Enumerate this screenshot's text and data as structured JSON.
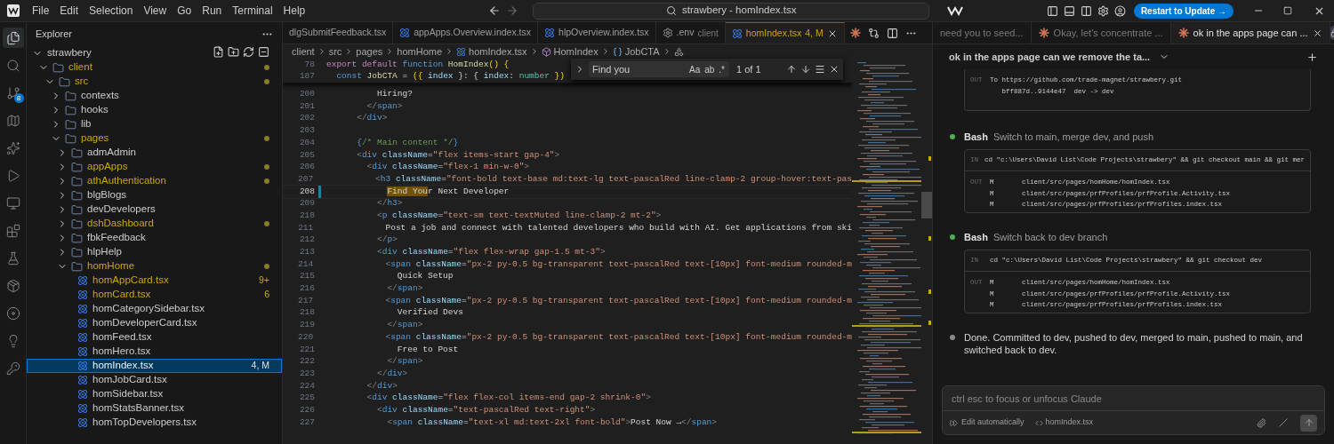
{
  "title_bar": {
    "menus": [
      "File",
      "Edit",
      "Selection",
      "View",
      "Go",
      "Run",
      "Terminal",
      "Help"
    ],
    "search": "strawbery - homIndex.tsx",
    "update_button": "Restart to Update →"
  },
  "activity_bar": [
    {
      "selected": true
    },
    {
      "selected": false
    },
    {
      "selected": false,
      "badge": "8"
    },
    {
      "selected": false
    },
    {
      "selected": false
    },
    {
      "selected": false
    },
    {
      "selected": false
    },
    {
      "selected": false
    },
    {
      "selected": false
    },
    {
      "selected": false
    },
    {
      "selected": false
    },
    {
      "selected": false
    },
    {
      "selected": false
    }
  ],
  "explorer": {
    "title": "Explorer",
    "tree": [
      {
        "kind": "folder",
        "name": "strawbery",
        "expanded": true,
        "modified": false,
        "children": [
          {
            "kind": "folder",
            "name": "client",
            "expanded": true,
            "modified": true,
            "children": [
              {
                "kind": "folder",
                "name": "src",
                "expanded": true,
                "modified": true,
                "children": [
                  {
                    "kind": "folder",
                    "name": "contexts",
                    "expanded": false,
                    "modified": false
                  },
                  {
                    "kind": "folder",
                    "name": "hooks",
                    "expanded": false,
                    "modified": false
                  },
                  {
                    "kind": "folder",
                    "name": "lib",
                    "expanded": false,
                    "modified": false
                  },
                  {
                    "kind": "folder",
                    "name": "pages",
                    "expanded": true,
                    "modified": true,
                    "children": [
                      {
                        "kind": "folder",
                        "name": "admAdmin",
                        "expanded": false,
                        "modified": false
                      },
                      {
                        "kind": "folder",
                        "name": "appApps",
                        "expanded": false,
                        "modified": true
                      },
                      {
                        "kind": "folder",
                        "name": "athAuthentication",
                        "expanded": false,
                        "modified": true
                      },
                      {
                        "kind": "folder",
                        "name": "blgBlogs",
                        "expanded": false,
                        "modified": false
                      },
                      {
                        "kind": "folder",
                        "name": "devDevelopers",
                        "expanded": false,
                        "modified": false
                      },
                      {
                        "kind": "folder",
                        "name": "dshDashboard",
                        "expanded": false,
                        "modified": true
                      },
                      {
                        "kind": "folder",
                        "name": "fbkFeedback",
                        "expanded": false,
                        "modified": false
                      },
                      {
                        "kind": "folder",
                        "name": "hlpHelp",
                        "expanded": false,
                        "modified": false
                      },
                      {
                        "kind": "folder",
                        "name": "homHome",
                        "expanded": true,
                        "modified": true,
                        "children": [
                          {
                            "kind": "file",
                            "name": "homAppCard.tsx",
                            "modified": true,
                            "badge": "9+",
                            "selected": false
                          },
                          {
                            "kind": "file",
                            "name": "homCard.tsx",
                            "modified": true,
                            "badge": "6",
                            "selected": false
                          },
                          {
                            "kind": "file",
                            "name": "homCategorySidebar.tsx",
                            "modified": false,
                            "selected": false
                          },
                          {
                            "kind": "file",
                            "name": "homDeveloperCard.tsx",
                            "modified": false,
                            "selected": false
                          },
                          {
                            "kind": "file",
                            "name": "homFeed.tsx",
                            "modified": false,
                            "selected": false
                          },
                          {
                            "kind": "file",
                            "name": "homHero.tsx",
                            "modified": false,
                            "selected": false
                          },
                          {
                            "kind": "file",
                            "name": "homIndex.tsx",
                            "modified": true,
                            "badge": "4, M",
                            "selected": true
                          },
                          {
                            "kind": "file",
                            "name": "homJobCard.tsx",
                            "modified": false,
                            "selected": false
                          },
                          {
                            "kind": "file",
                            "name": "homSidebar.tsx",
                            "modified": false,
                            "selected": false
                          },
                          {
                            "kind": "file",
                            "name": "homStatsBanner.tsx",
                            "modified": false,
                            "selected": false
                          },
                          {
                            "kind": "file",
                            "name": "homTopDevelopers.tsx",
                            "modified": false,
                            "selected": false
                          }
                        ]
                      }
                    ]
                  }
                ]
              }
            ]
          }
        ]
      }
    ]
  },
  "editor": {
    "tabs": [
      {
        "kind": "plain",
        "label": "dlgSubmitFeedback.tsx",
        "selected": false
      },
      {
        "kind": "react",
        "label": "appApps.Overview.index.tsx",
        "selected": false
      },
      {
        "kind": "react",
        "label": "hlpOverview.index.tsx",
        "selected": false
      },
      {
        "kind": "env",
        "label": ".env",
        "description": "client",
        "selected": false
      },
      {
        "kind": "react",
        "label": "homIndex.tsx",
        "decoration": "4, M",
        "selected": true
      }
    ],
    "breadcrumbs": [
      {
        "kind": "folder",
        "label": "client"
      },
      {
        "kind": "folder",
        "label": "src"
      },
      {
        "kind": "folder",
        "label": "pages"
      },
      {
        "kind": "folder",
        "label": "homHome"
      },
      {
        "kind": "react",
        "label": "homIndex.tsx"
      },
      {
        "kind": "component",
        "label": "HomIndex"
      },
      {
        "kind": "variable",
        "label": "JobCTA"
      }
    ],
    "find": {
      "value": "Find you",
      "toggles": [
        "Aa",
        "ab",
        ".*"
      ],
      "count": "1 of 1"
    },
    "sticky_lines": [
      {
        "num": "78",
        "current": false,
        "tokens": [
          {
            "t": "export default ",
            "kind": "keyword"
          },
          {
            "t": "function ",
            "kind": "storage"
          },
          {
            "t": "HomIndex",
            "kind": "function"
          },
          {
            "t": "() {",
            "kind": "bracket"
          }
        ]
      },
      {
        "num": "187",
        "current": false,
        "tokens": [
          {
            "t": "  const ",
            "kind": "storage"
          },
          {
            "t": "JobCTA",
            "kind": "function"
          },
          {
            "t": " = ",
            "kind": "punctuation"
          },
          {
            "t": "({ ",
            "kind": "bracket"
          },
          {
            "t": "index",
            "kind": "variable"
          },
          {
            "t": " }: { ",
            "kind": "punctuation"
          },
          {
            "t": "index",
            "kind": "variable"
          },
          {
            "t": ": ",
            "kind": "punctuation"
          },
          {
            "t": "number",
            "kind": "type"
          },
          {
            "t": " })",
            "kind": "bracket"
          }
        ]
      }
    ],
    "lines": [
      {
        "num": "200",
        "current": false,
        "tokens": [
          {
            "t": "          Hiring?",
            "kind": "text"
          }
        ]
      },
      {
        "num": "201",
        "current": false,
        "tokens": [
          {
            "t": "        </",
            "kind": "angle"
          },
          {
            "t": "span",
            "kind": "tag"
          },
          {
            "t": ">",
            "kind": "angle"
          }
        ]
      },
      {
        "num": "202",
        "current": false,
        "tokens": [
          {
            "t": "      </",
            "kind": "angle"
          },
          {
            "t": "div",
            "kind": "tag"
          },
          {
            "t": ">",
            "kind": "angle"
          }
        ]
      },
      {
        "num": "203",
        "current": false
      },
      {
        "num": "204",
        "current": false,
        "tokens": [
          {
            "t": "      {",
            "kind": "tag"
          },
          {
            "t": "/* Main content */",
            "kind": "comment"
          },
          {
            "t": "}",
            "kind": "tag"
          }
        ]
      },
      {
        "num": "205",
        "current": false,
        "tokens": [
          {
            "t": "      <",
            "kind": "angle"
          },
          {
            "t": "div",
            "kind": "tag"
          },
          {
            "t": " className",
            "kind": "attribute"
          },
          {
            "t": "=",
            "kind": "punctuation"
          },
          {
            "t": "\"flex items-start gap-4\"",
            "kind": "string"
          },
          {
            "t": ">",
            "kind": "angle"
          }
        ]
      },
      {
        "num": "206",
        "current": false,
        "tokens": [
          {
            "t": "        <",
            "kind": "angle"
          },
          {
            "t": "div",
            "kind": "tag"
          },
          {
            "t": " className",
            "kind": "attribute"
          },
          {
            "t": "=",
            "kind": "punctuation"
          },
          {
            "t": "\"flex-1 min-w-0\"",
            "kind": "string"
          },
          {
            "t": ">",
            "kind": "angle"
          }
        ]
      },
      {
        "num": "207",
        "current": false,
        "tokens": [
          {
            "t": "          <",
            "kind": "angle"
          },
          {
            "t": "h3",
            "kind": "tag"
          },
          {
            "t": " className",
            "kind": "attribute"
          },
          {
            "t": "=",
            "kind": "punctuation"
          },
          {
            "t": "\"font-bold text-base md:text-lg text-pascalRed line-clamp-2 group-hover:text-pas",
            "kind": "string"
          }
        ]
      },
      {
        "num": "208",
        "current": true,
        "tokens": [
          {
            "t": "            Find You",
            "kind": "match"
          },
          {
            "t": "r Next Developer",
            "kind": "text"
          }
        ]
      },
      {
        "num": "209",
        "current": false,
        "tokens": [
          {
            "t": "          </",
            "kind": "angle"
          },
          {
            "t": "h3",
            "kind": "tag"
          },
          {
            "t": ">",
            "kind": "angle"
          }
        ]
      },
      {
        "num": "210",
        "current": false,
        "tokens": [
          {
            "t": "          <",
            "kind": "angle"
          },
          {
            "t": "p",
            "kind": "tag"
          },
          {
            "t": " className",
            "kind": "attribute"
          },
          {
            "t": "=",
            "kind": "punctuation"
          },
          {
            "t": "\"text-sm text-textMuted line-clamp-2 mt-2\"",
            "kind": "string"
          },
          {
            "t": ">",
            "kind": "angle"
          }
        ]
      },
      {
        "num": "211",
        "current": false,
        "tokens": [
          {
            "t": "            Post a job and connect with talented developers who build with AI. Get applications from ski",
            "kind": "text"
          }
        ]
      },
      {
        "num": "212",
        "current": false,
        "tokens": [
          {
            "t": "          </",
            "kind": "angle"
          },
          {
            "t": "p",
            "kind": "tag"
          },
          {
            "t": ">",
            "kind": "angle"
          }
        ]
      },
      {
        "num": "213",
        "current": false,
        "tokens": [
          {
            "t": "          <",
            "kind": "angle"
          },
          {
            "t": "div",
            "kind": "tag"
          },
          {
            "t": " className",
            "kind": "attribute"
          },
          {
            "t": "=",
            "kind": "punctuation"
          },
          {
            "t": "\"flex flex-wrap gap-1.5 mt-3\"",
            "kind": "string"
          },
          {
            "t": ">",
            "kind": "angle"
          }
        ]
      },
      {
        "num": "214",
        "current": false,
        "tokens": [
          {
            "t": "            <",
            "kind": "angle"
          },
          {
            "t": "span",
            "kind": "tag"
          },
          {
            "t": " className",
            "kind": "attribute"
          },
          {
            "t": "=",
            "kind": "punctuation"
          },
          {
            "t": "\"px-2 py-0.5 bg-transparent text-pascalRed text-[10px] font-medium rounded-m",
            "kind": "string"
          }
        ]
      },
      {
        "num": "215",
        "current": false,
        "tokens": [
          {
            "t": "              Quick Setup",
            "kind": "text"
          }
        ]
      },
      {
        "num": "216",
        "current": false,
        "tokens": [
          {
            "t": "            </",
            "kind": "angle"
          },
          {
            "t": "span",
            "kind": "tag"
          },
          {
            "t": ">",
            "kind": "angle"
          }
        ]
      },
      {
        "num": "217",
        "current": false,
        "tokens": [
          {
            "t": "            <",
            "kind": "angle"
          },
          {
            "t": "span",
            "kind": "tag"
          },
          {
            "t": " className",
            "kind": "attribute"
          },
          {
            "t": "=",
            "kind": "punctuation"
          },
          {
            "t": "\"px-2 py-0.5 bg-transparent text-pascalRed text-[10px] font-medium rounded-m",
            "kind": "string"
          }
        ]
      },
      {
        "num": "218",
        "current": false,
        "tokens": [
          {
            "t": "              Verified Devs",
            "kind": "text"
          }
        ]
      },
      {
        "num": "219",
        "current": false,
        "tokens": [
          {
            "t": "            </",
            "kind": "angle"
          },
          {
            "t": "span",
            "kind": "tag"
          },
          {
            "t": ">",
            "kind": "angle"
          }
        ]
      },
      {
        "num": "220",
        "current": false,
        "tokens": [
          {
            "t": "            <",
            "kind": "angle"
          },
          {
            "t": "span",
            "kind": "tag"
          },
          {
            "t": " className",
            "kind": "attribute"
          },
          {
            "t": "=",
            "kind": "punctuation"
          },
          {
            "t": "\"px-2 py-0.5 bg-transparent text-pascalRed text-[10px] font-medium rounded-m",
            "kind": "string"
          }
        ]
      },
      {
        "num": "221",
        "current": false,
        "tokens": [
          {
            "t": "              Free to Post",
            "kind": "text"
          }
        ]
      },
      {
        "num": "222",
        "current": false,
        "tokens": [
          {
            "t": "            </",
            "kind": "angle"
          },
          {
            "t": "span",
            "kind": "tag"
          },
          {
            "t": ">",
            "kind": "angle"
          }
        ]
      },
      {
        "num": "223",
        "current": false,
        "tokens": [
          {
            "t": "          </",
            "kind": "angle"
          },
          {
            "t": "div",
            "kind": "tag"
          },
          {
            "t": ">",
            "kind": "angle"
          }
        ]
      },
      {
        "num": "224",
        "current": false,
        "tokens": [
          {
            "t": "        </",
            "kind": "angle"
          },
          {
            "t": "div",
            "kind": "tag"
          },
          {
            "t": ">",
            "kind": "angle"
          }
        ]
      },
      {
        "num": "225",
        "current": false,
        "tokens": [
          {
            "t": "        <",
            "kind": "angle"
          },
          {
            "t": "div",
            "kind": "tag"
          },
          {
            "t": " className",
            "kind": "attribute"
          },
          {
            "t": "=",
            "kind": "punctuation"
          },
          {
            "t": "\"flex flex-col items-end gap-2 shrink-0\"",
            "kind": "string"
          },
          {
            "t": ">",
            "kind": "angle"
          }
        ]
      },
      {
        "num": "226",
        "current": false,
        "tokens": [
          {
            "t": "          <",
            "kind": "angle"
          },
          {
            "t": "div",
            "kind": "tag"
          },
          {
            "t": " className",
            "kind": "attribute"
          },
          {
            "t": "=",
            "kind": "punctuation"
          },
          {
            "t": "\"text-pascalRed text-right\"",
            "kind": "string"
          },
          {
            "t": ">",
            "kind": "angle"
          }
        ]
      },
      {
        "num": "227",
        "current": false,
        "tokens": [
          {
            "t": "            <",
            "kind": "angle"
          },
          {
            "t": "span",
            "kind": "tag"
          },
          {
            "t": " className",
            "kind": "attribute"
          },
          {
            "t": "=",
            "kind": "punctuation"
          },
          {
            "t": "\"text-xl md:text-2xl font-bold\"",
            "kind": "string"
          },
          {
            "t": ">",
            "kind": "angle"
          },
          {
            "t": "Post Now →",
            "kind": "text"
          },
          {
            "t": "</",
            "kind": "angle"
          },
          {
            "t": "span",
            "kind": "tag"
          },
          {
            "t": ">",
            "kind": "angle"
          }
        ]
      }
    ]
  },
  "chat": {
    "tabs": [
      {
        "kind": "plain",
        "label": "need you to seed...",
        "selected": false
      },
      {
        "kind": "claude",
        "label": "Okay, let's concentrate ...",
        "selected": false
      },
      {
        "kind": "claude",
        "label": "ok in the apps page can ...",
        "selected": true
      }
    ],
    "title": "ok in the apps page can we remove the ta...",
    "messages": [
      {
        "kind": "output",
        "out_label": "OUT",
        "out": [
          "To https://github.com/trade-magnet/strawbery.git",
          "   bff887d..9144e47  dev -> dev"
        ]
      },
      {
        "kind": "tool",
        "color": "#4caf50",
        "tool": "Bash",
        "description": "Switch to main, merge dev, and push",
        "in_label": "IN",
        "command": "cd \"c:\\Users\\David List\\Code Projects\\strawbery\" && git checkout main && git mer",
        "out_label": "OUT",
        "out": [
          "M       client/src/pages/homHome/homIndex.tsx",
          "M       client/src/pages/prfProfiles/prfProfile.Activity.tsx",
          "M       client/src/pages/prfProfiles/prfProfiles.index.tsx"
        ]
      },
      {
        "kind": "tool",
        "color": "#4caf50",
        "tool": "Bash",
        "description": "Switch back to dev branch",
        "in_label": "IN",
        "command": "cd \"c:\\Users\\David List\\Code Projects\\strawbery\" && git checkout dev",
        "out_label": "OUT",
        "out": [
          "M       client/src/pages/homHome/homIndex.tsx",
          "M       client/src/pages/prfProfiles/prfProfile.Activity.tsx",
          "M       client/src/pages/prfProfiles/prfProfiles.index.tsx"
        ]
      },
      {
        "kind": "text",
        "color": "#8a8a8a",
        "text": "Done. Committed to dev, pushed to dev, merged to main, pushed to main, and switched back to dev."
      }
    ],
    "composer": {
      "placeholder": "ctrl esc to focus or unfocus Claude",
      "mode": "Edit automatically",
      "file": "homIndex.tsx"
    }
  }
}
